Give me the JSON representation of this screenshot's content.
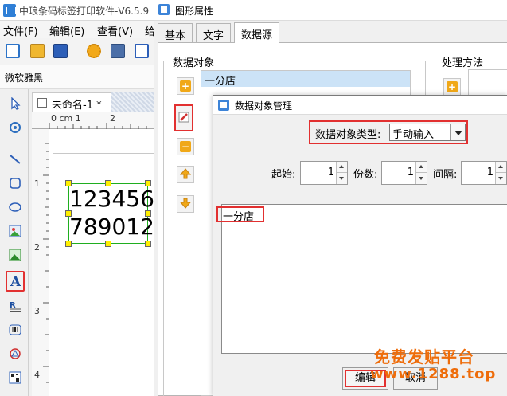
{
  "app": {
    "title": "中琅条码标签打印软件-V6.5.9"
  },
  "menubar": {
    "items": [
      "文件(F)",
      "编辑(E)",
      "查看(V)",
      "给"
    ]
  },
  "fontbar": {
    "font_name": "微软雅黑"
  },
  "document": {
    "tab_title": "未命名-1 *",
    "ruler_h_label": "0 cm 1",
    "ruler_h_mark": "2",
    "ruler_v_labels": [
      "1",
      "2",
      "3",
      "4"
    ],
    "text_lines": [
      "123456",
      "789012"
    ]
  },
  "properties_dialog": {
    "title": "图形属性",
    "tabs": [
      {
        "label": "基本",
        "active": false
      },
      {
        "label": "文字",
        "active": false
      },
      {
        "label": "数据源",
        "active": true
      }
    ],
    "data_object_group_label": "数据对象",
    "data_object_items": [
      "一分店"
    ],
    "process_method_label": "处理方法"
  },
  "data_object_manager": {
    "title": "数据对象管理",
    "type_label": "数据对象类型:",
    "type_value": "手动输入",
    "start_label": "起始:",
    "start_value": "1",
    "copies_label": "份数:",
    "copies_value": "1",
    "interval_label": "间隔:",
    "interval_value": "1",
    "content_text": "一分店",
    "edit_label": "编辑",
    "cancel_label": "取消"
  },
  "watermark": {
    "line1": "免费发贴平台",
    "line2": "www.1288.top"
  },
  "colors": {
    "highlight_red": "#e23030",
    "selection_green": "#1fae1f",
    "handle_yellow": "#ffef00",
    "list_selection": "#cce3f7",
    "watermark_orange": "#ee6c0a"
  }
}
